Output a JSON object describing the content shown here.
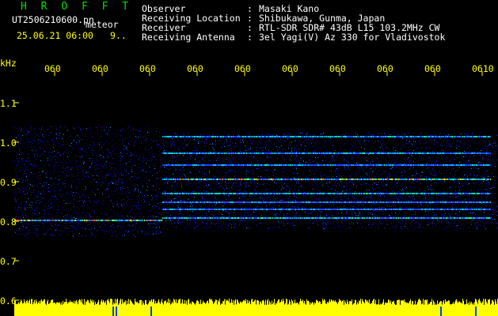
{
  "header": {
    "title": "H R O F F T",
    "filename": "UT2506210600.pn",
    "tag": "meteor",
    "datetime": "25.06.21 06:00",
    "partial": "9.."
  },
  "info": [
    {
      "label": "Observer",
      "value": "Masaki Kano"
    },
    {
      "label": "Receiving Location",
      "value": "Shibukawa, Gunma, Japan"
    },
    {
      "label": "Receiver",
      "value": "RTL-SDR SDR# 43dB L15 103.2MHz CW"
    },
    {
      "label": "Receiving Antenna",
      "value": "3el Yagi(V) Az 330 for Vladivostok"
    }
  ],
  "axis": {
    "unit": "kHz",
    "time_ticks": [
      "060",
      "060",
      "060",
      "060",
      "060",
      "060",
      "060",
      "060",
      "060",
      "0610"
    ],
    "freq_ticks": [
      "1.1",
      "1.0",
      "0.9",
      "0.8",
      "0.7",
      "0.6"
    ]
  },
  "colors": {
    "background": "#000000",
    "title": "#00e000",
    "labels": "#ffff00",
    "info": "#ffffff",
    "spectrum_base": "#0000c8",
    "amplitude": "#ffff00"
  }
}
